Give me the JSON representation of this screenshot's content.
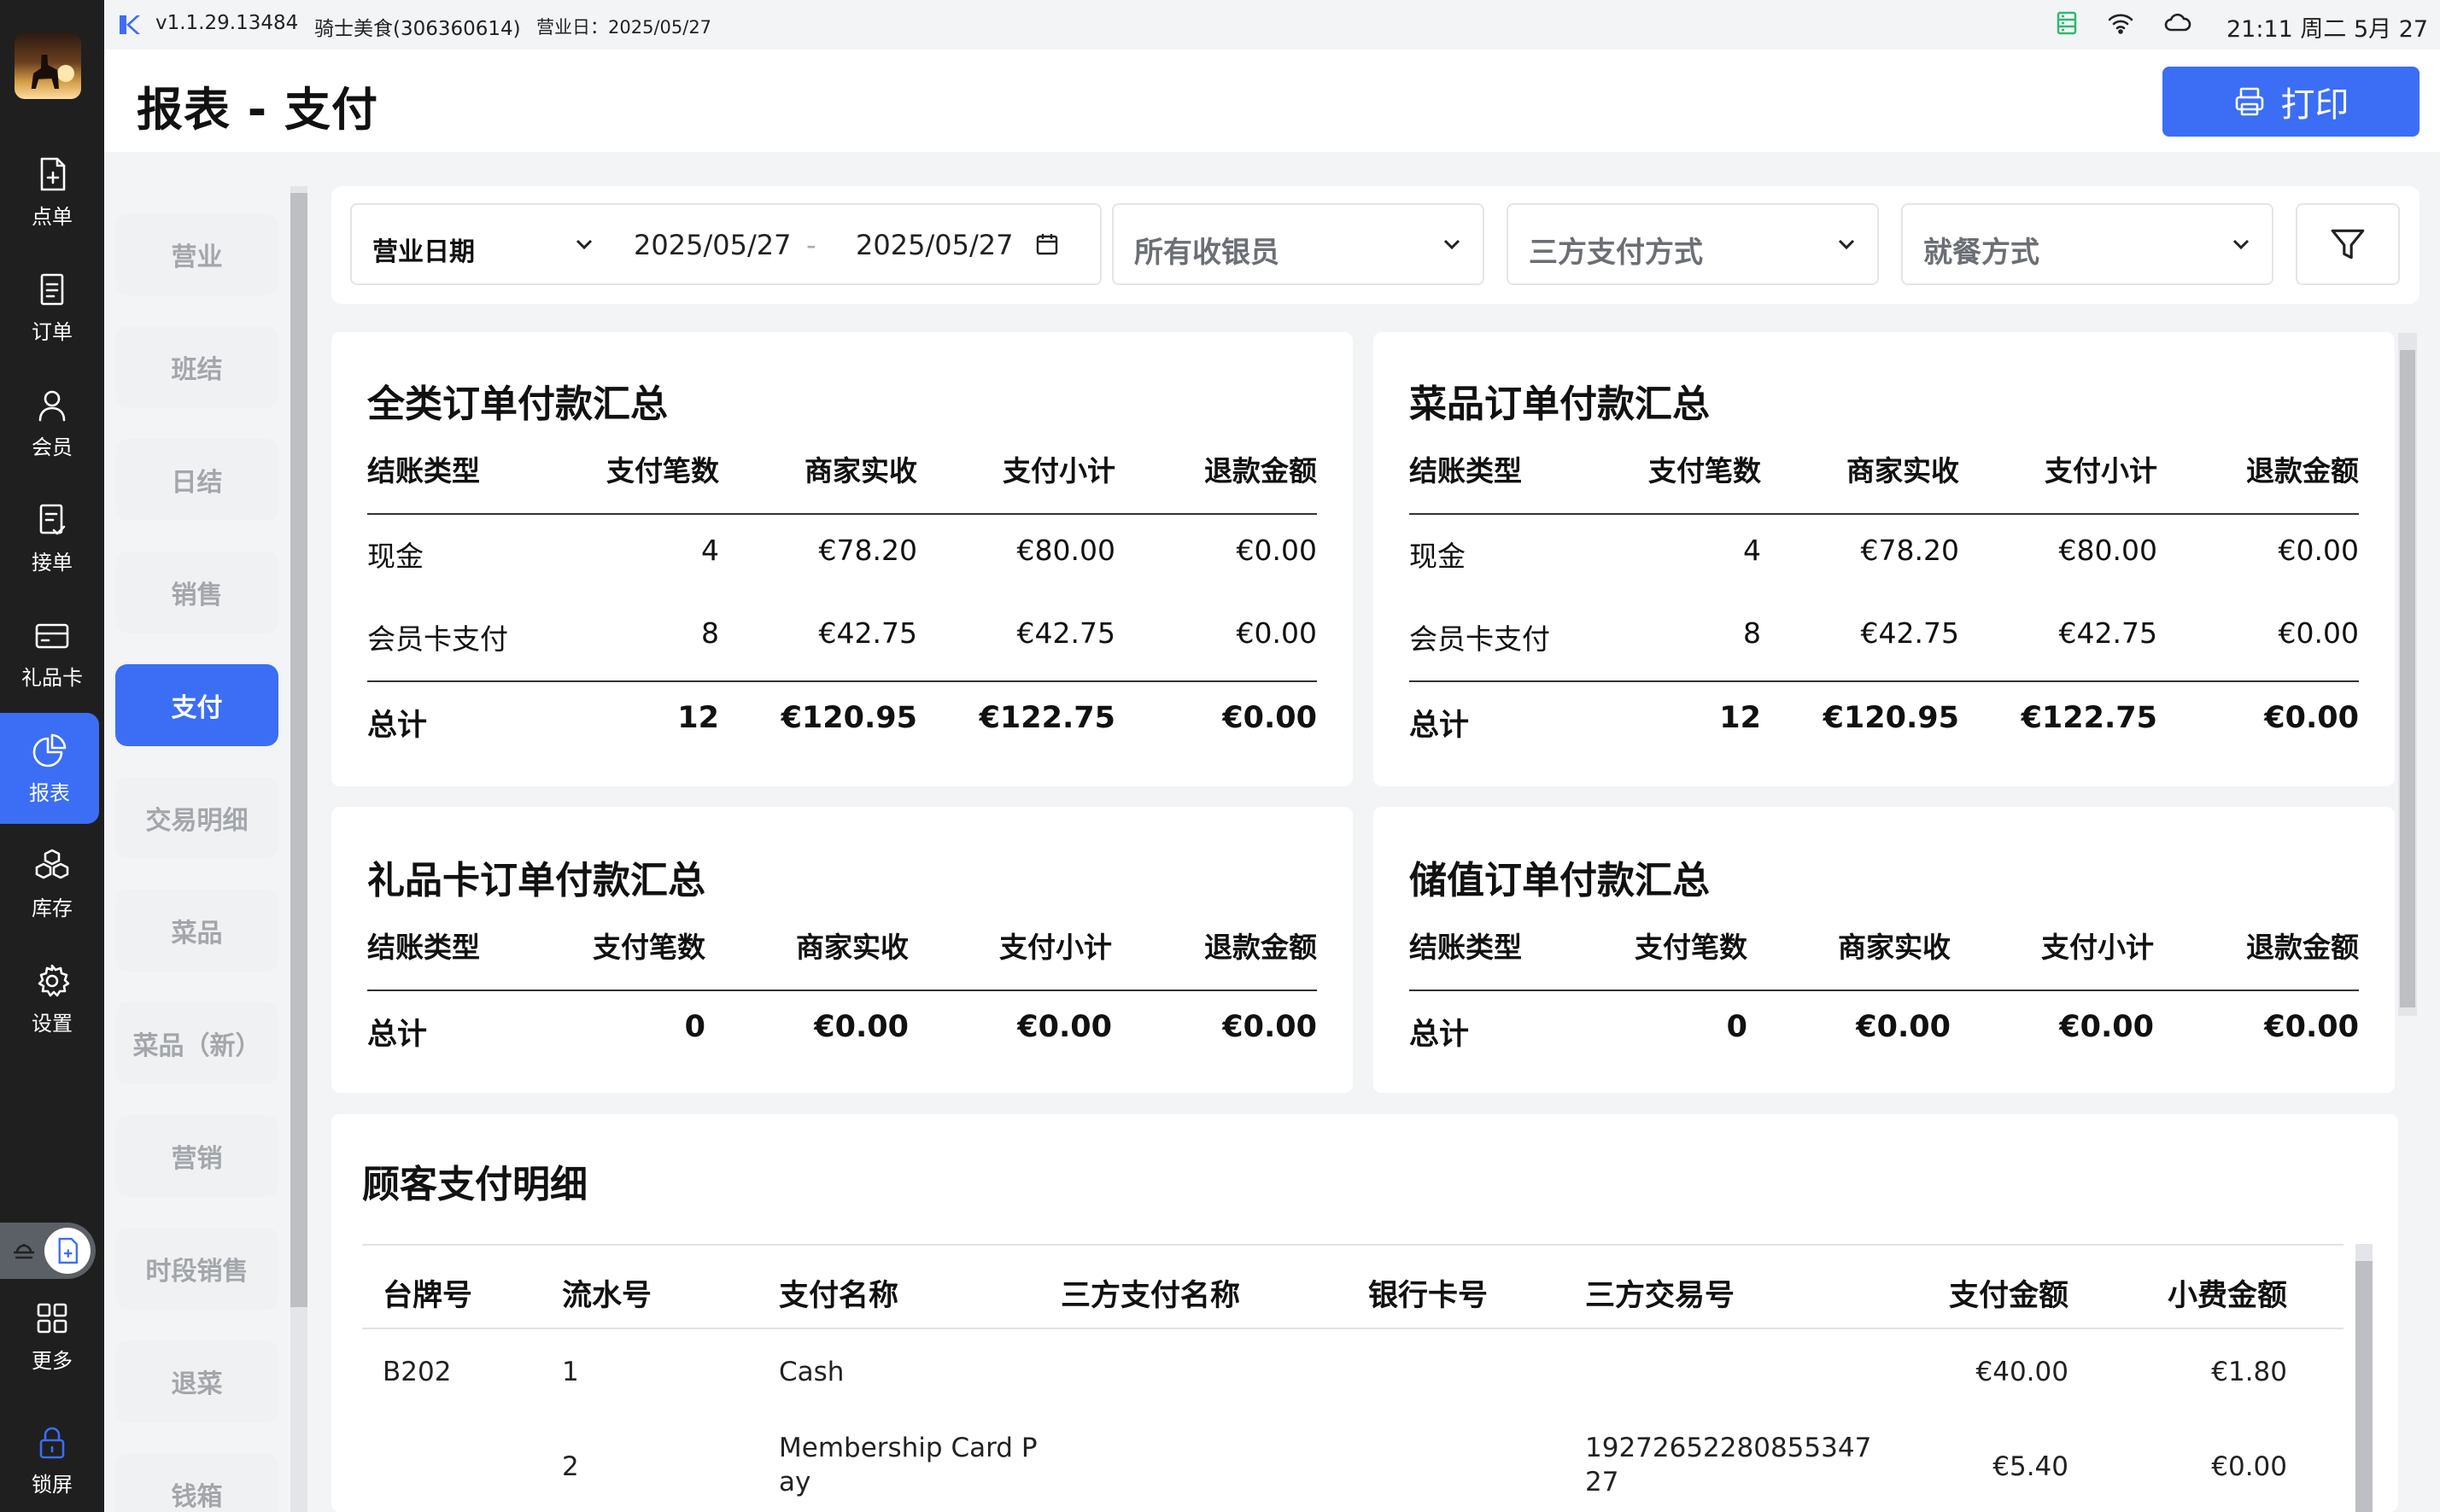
{
  "status": {
    "version": "v1.1.29.13484",
    "store": "骑士美食(306360614)",
    "business_day": "营业日：2025/05/27",
    "clock": "21:11 周二 5月 27日"
  },
  "sidebar": {
    "items": [
      {
        "label": "点单",
        "icon": "new-order-icon"
      },
      {
        "label": "订单",
        "icon": "orders-icon"
      },
      {
        "label": "会员",
        "icon": "member-icon"
      },
      {
        "label": "接单",
        "icon": "accept-order-icon"
      },
      {
        "label": "礼品卡",
        "icon": "gift-card-icon"
      },
      {
        "label": "报表",
        "icon": "report-pie-icon"
      },
      {
        "label": "库存",
        "icon": "inventory-icon"
      },
      {
        "label": "设置",
        "icon": "settings-gear-icon"
      },
      {
        "label": "更多",
        "icon": "more-grid-icon"
      },
      {
        "label": "锁屏",
        "icon": "lock-icon"
      }
    ],
    "active": "报表"
  },
  "header": {
    "title": "报表 - 支付",
    "print_label": "打印"
  },
  "subnav": {
    "items": [
      "营业",
      "班结",
      "日结",
      "销售",
      "支付",
      "交易明细",
      "菜品",
      "菜品（新）",
      "营销",
      "时段销售",
      "退菜",
      "钱箱"
    ],
    "active": "支付"
  },
  "filters": {
    "date_type": "营业日期",
    "date_from": "2025/05/27",
    "date_sep": "-",
    "date_to": "2025/05/27",
    "cashier": "所有收银员",
    "third_party_payment": "三方支付方式",
    "dining_mode": "就餐方式"
  },
  "columns": [
    "结账类型",
    "支付笔数",
    "商家实收",
    "支付小计",
    "退款金额"
  ],
  "cards": {
    "all": {
      "title": "全类订单付款汇总",
      "rows": [
        [
          "现金",
          "4",
          "€78.20",
          "€80.00",
          "€0.00"
        ],
        [
          "会员卡支付",
          "8",
          "€42.75",
          "€42.75",
          "€0.00"
        ]
      ],
      "total": [
        "总计",
        "12",
        "€120.95",
        "€122.75",
        "€0.00"
      ]
    },
    "dish": {
      "title": "菜品订单付款汇总",
      "rows": [
        [
          "现金",
          "4",
          "€78.20",
          "€80.00",
          "€0.00"
        ],
        [
          "会员卡支付",
          "8",
          "€42.75",
          "€42.75",
          "€0.00"
        ]
      ],
      "total": [
        "总计",
        "12",
        "€120.95",
        "€122.75",
        "€0.00"
      ]
    },
    "giftcard": {
      "title": "礼品卡订单付款汇总",
      "total": [
        "总计",
        "0",
        "€0.00",
        "€0.00",
        "€0.00"
      ]
    },
    "stored": {
      "title": "储值订单付款汇总",
      "total": [
        "总计",
        "0",
        "€0.00",
        "€0.00",
        "€0.00"
      ]
    }
  },
  "detail": {
    "title": "顾客支付明细",
    "columns": [
      "台牌号",
      "流水号",
      "支付名称",
      "三方支付名称",
      "银行卡号",
      "三方交易号",
      "支付金额",
      "小费金额"
    ],
    "rows": [
      {
        "table": "B202",
        "serial": "1",
        "pay_name_1": "Cash",
        "pay_name_2": "",
        "third_name": "",
        "card": "",
        "txn_1": "",
        "txn_2": "",
        "amount": "€40.00",
        "tip": "€1.80"
      },
      {
        "table": "",
        "serial": "2",
        "pay_name_1": "Membership Card P",
        "pay_name_2": "ay",
        "third_name": "",
        "card": "",
        "txn_1": "19272652280855347",
        "txn_2": "27",
        "amount": "€5.40",
        "tip": "€0.00"
      }
    ]
  }
}
